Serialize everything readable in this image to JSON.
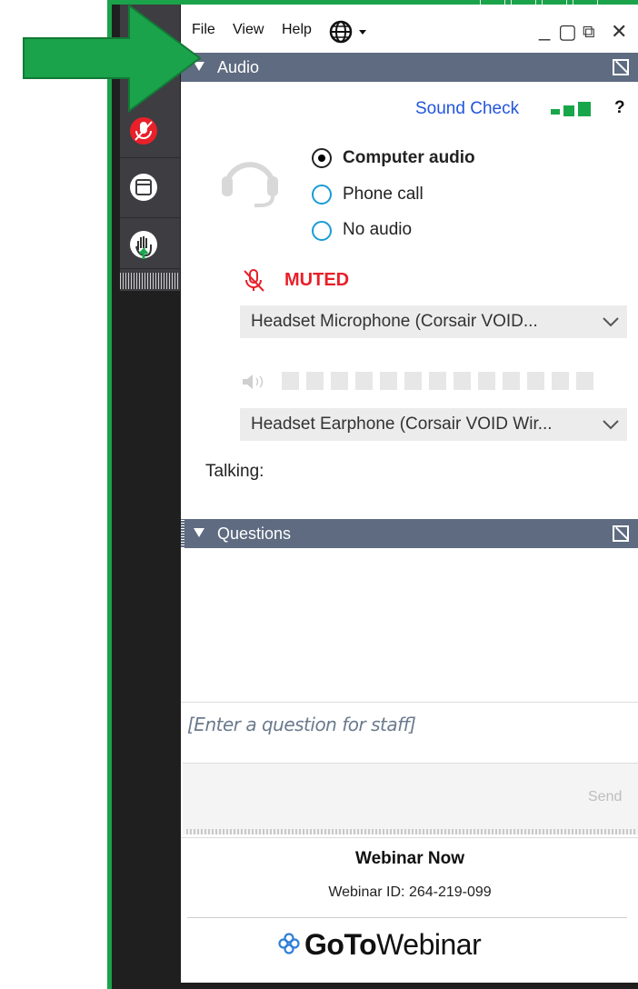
{
  "menu": {
    "file": "File",
    "view": "View",
    "help": "Help",
    "language_icon": "globe-icon"
  },
  "window_controls": {
    "minimize": "_",
    "maximize": "▢",
    "popout": "⧉",
    "close": "✕"
  },
  "audio": {
    "section_title": "Audio",
    "sound_check": "Sound Check",
    "help": "?",
    "options": [
      {
        "label": "Computer audio",
        "selected": true
      },
      {
        "label": "Phone call",
        "selected": false
      },
      {
        "label": "No audio",
        "selected": false
      }
    ],
    "mic_status": "MUTED",
    "microphone": "Headset Microphone (Corsair VOID...",
    "speaker": "Headset Earphone (Corsair VOID Wir...",
    "talking_label": "Talking:",
    "status_color": "#e8202a",
    "bar_color": "#18a64a"
  },
  "questions": {
    "section_title": "Questions",
    "placeholder": "[Enter a question for staff]",
    "send_label": "Send"
  },
  "footer": {
    "title": "Webinar Now",
    "webinar_id": "Webinar ID: 264-219-099",
    "brand_bold": "GoTo",
    "brand_regular": "Webinar"
  },
  "colors": {
    "frame_green": "#1aa34a",
    "header_bar": "#5e6b80",
    "rail": "#3d3d42",
    "link_blue": "#2255dd"
  }
}
